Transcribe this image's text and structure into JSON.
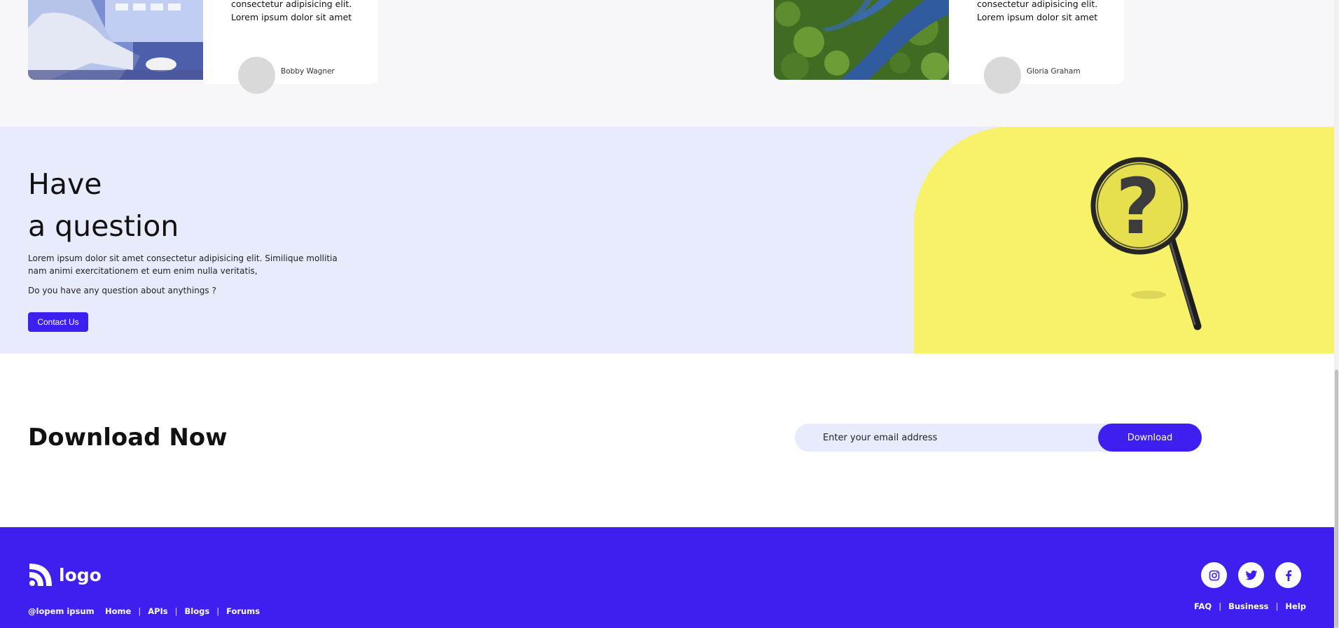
{
  "testimonials": [
    {
      "text_lines": [
        "consectetur adipisicing elit.",
        "Lorem ipsum dolor sit amet"
      ],
      "author": "Bobby Wagner",
      "image": "office-computer-photo"
    },
    {
      "text_lines": [
        "consectetur adipisicing elit.",
        "Lorem ipsum dolor sit amet"
      ],
      "author": "Gloria Graham",
      "image": "river-forest-aerial-photo"
    }
  ],
  "question": {
    "title_line1": "Have",
    "title_line2": "a question",
    "description": "Lorem ipsum dolor sit amet consectetur adipisicing elit. Similique mollitia nam animi exercitationem et eum enim nulla veritatis,",
    "ask": "Do you have any question about anythings ?",
    "button_label": "Contact Us",
    "image": "magnifier-question-mark",
    "question_mark": "?"
  },
  "download": {
    "title": "Download Now",
    "email_placeholder": "Enter your email address",
    "button_label": "Download"
  },
  "footer": {
    "logo_text": "logo",
    "copyright": "@lopem ipsum",
    "nav": [
      "Home",
      "APIs",
      "Blogs",
      "Forums"
    ],
    "social": [
      "instagram-icon",
      "twitter-icon",
      "facebook-icon"
    ],
    "links": [
      "FAQ",
      "Business",
      "Help"
    ]
  },
  "colors": {
    "brand": "#3d1ff0",
    "question_bg": "#e8ebfb",
    "yellow": "#f7f26a",
    "page_bg": "#f7f7f9"
  }
}
